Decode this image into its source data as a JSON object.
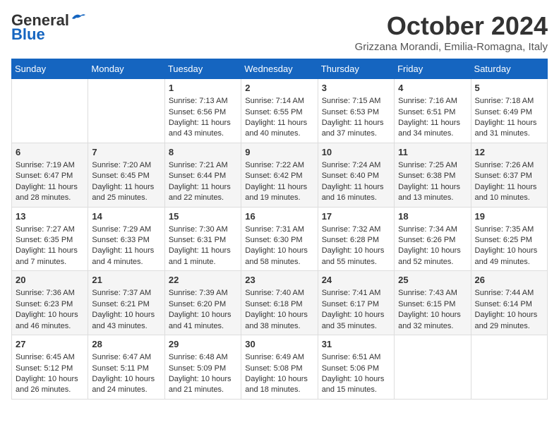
{
  "header": {
    "logo_line1": "General",
    "logo_line2": "Blue",
    "month_title": "October 2024",
    "subtitle": "Grizzana Morandi, Emilia-Romagna, Italy"
  },
  "columns": [
    "Sunday",
    "Monday",
    "Tuesday",
    "Wednesday",
    "Thursday",
    "Friday",
    "Saturday"
  ],
  "weeks": [
    [
      {
        "day": "",
        "sunrise": "",
        "sunset": "",
        "daylight": ""
      },
      {
        "day": "",
        "sunrise": "",
        "sunset": "",
        "daylight": ""
      },
      {
        "day": "1",
        "sunrise": "Sunrise: 7:13 AM",
        "sunset": "Sunset: 6:56 PM",
        "daylight": "Daylight: 11 hours and 43 minutes."
      },
      {
        "day": "2",
        "sunrise": "Sunrise: 7:14 AM",
        "sunset": "Sunset: 6:55 PM",
        "daylight": "Daylight: 11 hours and 40 minutes."
      },
      {
        "day": "3",
        "sunrise": "Sunrise: 7:15 AM",
        "sunset": "Sunset: 6:53 PM",
        "daylight": "Daylight: 11 hours and 37 minutes."
      },
      {
        "day": "4",
        "sunrise": "Sunrise: 7:16 AM",
        "sunset": "Sunset: 6:51 PM",
        "daylight": "Daylight: 11 hours and 34 minutes."
      },
      {
        "day": "5",
        "sunrise": "Sunrise: 7:18 AM",
        "sunset": "Sunset: 6:49 PM",
        "daylight": "Daylight: 11 hours and 31 minutes."
      }
    ],
    [
      {
        "day": "6",
        "sunrise": "Sunrise: 7:19 AM",
        "sunset": "Sunset: 6:47 PM",
        "daylight": "Daylight: 11 hours and 28 minutes."
      },
      {
        "day": "7",
        "sunrise": "Sunrise: 7:20 AM",
        "sunset": "Sunset: 6:45 PM",
        "daylight": "Daylight: 11 hours and 25 minutes."
      },
      {
        "day": "8",
        "sunrise": "Sunrise: 7:21 AM",
        "sunset": "Sunset: 6:44 PM",
        "daylight": "Daylight: 11 hours and 22 minutes."
      },
      {
        "day": "9",
        "sunrise": "Sunrise: 7:22 AM",
        "sunset": "Sunset: 6:42 PM",
        "daylight": "Daylight: 11 hours and 19 minutes."
      },
      {
        "day": "10",
        "sunrise": "Sunrise: 7:24 AM",
        "sunset": "Sunset: 6:40 PM",
        "daylight": "Daylight: 11 hours and 16 minutes."
      },
      {
        "day": "11",
        "sunrise": "Sunrise: 7:25 AM",
        "sunset": "Sunset: 6:38 PM",
        "daylight": "Daylight: 11 hours and 13 minutes."
      },
      {
        "day": "12",
        "sunrise": "Sunrise: 7:26 AM",
        "sunset": "Sunset: 6:37 PM",
        "daylight": "Daylight: 11 hours and 10 minutes."
      }
    ],
    [
      {
        "day": "13",
        "sunrise": "Sunrise: 7:27 AM",
        "sunset": "Sunset: 6:35 PM",
        "daylight": "Daylight: 11 hours and 7 minutes."
      },
      {
        "day": "14",
        "sunrise": "Sunrise: 7:29 AM",
        "sunset": "Sunset: 6:33 PM",
        "daylight": "Daylight: 11 hours and 4 minutes."
      },
      {
        "day": "15",
        "sunrise": "Sunrise: 7:30 AM",
        "sunset": "Sunset: 6:31 PM",
        "daylight": "Daylight: 11 hours and 1 minute."
      },
      {
        "day": "16",
        "sunrise": "Sunrise: 7:31 AM",
        "sunset": "Sunset: 6:30 PM",
        "daylight": "Daylight: 10 hours and 58 minutes."
      },
      {
        "day": "17",
        "sunrise": "Sunrise: 7:32 AM",
        "sunset": "Sunset: 6:28 PM",
        "daylight": "Daylight: 10 hours and 55 minutes."
      },
      {
        "day": "18",
        "sunrise": "Sunrise: 7:34 AM",
        "sunset": "Sunset: 6:26 PM",
        "daylight": "Daylight: 10 hours and 52 minutes."
      },
      {
        "day": "19",
        "sunrise": "Sunrise: 7:35 AM",
        "sunset": "Sunset: 6:25 PM",
        "daylight": "Daylight: 10 hours and 49 minutes."
      }
    ],
    [
      {
        "day": "20",
        "sunrise": "Sunrise: 7:36 AM",
        "sunset": "Sunset: 6:23 PM",
        "daylight": "Daylight: 10 hours and 46 minutes."
      },
      {
        "day": "21",
        "sunrise": "Sunrise: 7:37 AM",
        "sunset": "Sunset: 6:21 PM",
        "daylight": "Daylight: 10 hours and 43 minutes."
      },
      {
        "day": "22",
        "sunrise": "Sunrise: 7:39 AM",
        "sunset": "Sunset: 6:20 PM",
        "daylight": "Daylight: 10 hours and 41 minutes."
      },
      {
        "day": "23",
        "sunrise": "Sunrise: 7:40 AM",
        "sunset": "Sunset: 6:18 PM",
        "daylight": "Daylight: 10 hours and 38 minutes."
      },
      {
        "day": "24",
        "sunrise": "Sunrise: 7:41 AM",
        "sunset": "Sunset: 6:17 PM",
        "daylight": "Daylight: 10 hours and 35 minutes."
      },
      {
        "day": "25",
        "sunrise": "Sunrise: 7:43 AM",
        "sunset": "Sunset: 6:15 PM",
        "daylight": "Daylight: 10 hours and 32 minutes."
      },
      {
        "day": "26",
        "sunrise": "Sunrise: 7:44 AM",
        "sunset": "Sunset: 6:14 PM",
        "daylight": "Daylight: 10 hours and 29 minutes."
      }
    ],
    [
      {
        "day": "27",
        "sunrise": "Sunrise: 6:45 AM",
        "sunset": "Sunset: 5:12 PM",
        "daylight": "Daylight: 10 hours and 26 minutes."
      },
      {
        "day": "28",
        "sunrise": "Sunrise: 6:47 AM",
        "sunset": "Sunset: 5:11 PM",
        "daylight": "Daylight: 10 hours and 24 minutes."
      },
      {
        "day": "29",
        "sunrise": "Sunrise: 6:48 AM",
        "sunset": "Sunset: 5:09 PM",
        "daylight": "Daylight: 10 hours and 21 minutes."
      },
      {
        "day": "30",
        "sunrise": "Sunrise: 6:49 AM",
        "sunset": "Sunset: 5:08 PM",
        "daylight": "Daylight: 10 hours and 18 minutes."
      },
      {
        "day": "31",
        "sunrise": "Sunrise: 6:51 AM",
        "sunset": "Sunset: 5:06 PM",
        "daylight": "Daylight: 10 hours and 15 minutes."
      },
      {
        "day": "",
        "sunrise": "",
        "sunset": "",
        "daylight": ""
      },
      {
        "day": "",
        "sunrise": "",
        "sunset": "",
        "daylight": ""
      }
    ]
  ]
}
